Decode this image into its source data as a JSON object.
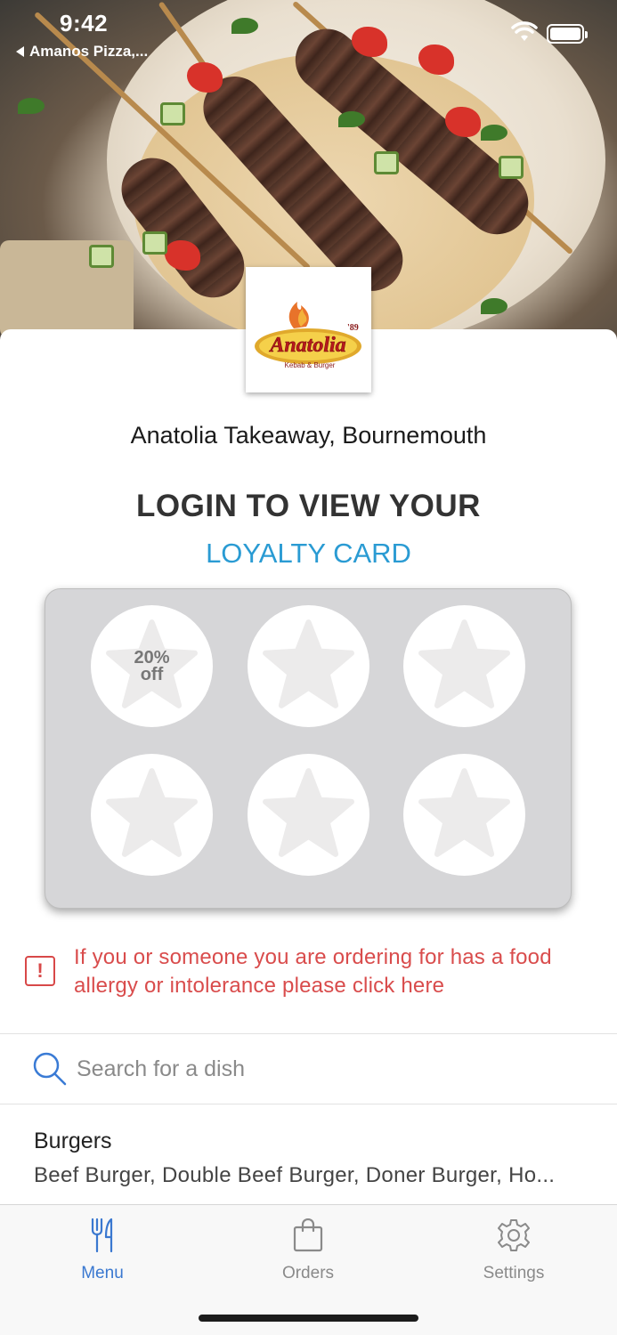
{
  "status_bar": {
    "time": "9:42",
    "back_app": "Amanos Pizza,..."
  },
  "restaurant": {
    "name": "Anatolia Takeaway, Bournemouth",
    "logo_text": "Anatolia",
    "logo_subtext": "Kebab & Burger",
    "logo_year": "'89"
  },
  "loyalty": {
    "heading": "LOGIN TO VIEW YOUR",
    "subheading": "LOYALTY CARD",
    "stamps": [
      {
        "label": "20%\noff"
      },
      {
        "label": ""
      },
      {
        "label": ""
      },
      {
        "label": ""
      },
      {
        "label": ""
      },
      {
        "label": ""
      }
    ],
    "stamp_label_line1": "20%",
    "stamp_label_line2": "off"
  },
  "allergy": {
    "text": "If you or someone you are ordering for has a food allergy or intolerance please click here",
    "color": "#d94c4c"
  },
  "search": {
    "placeholder": "Search for a dish"
  },
  "menu": {
    "categories": [
      {
        "title": "Burgers",
        "items": "Beef Burger, Double Beef Burger, Doner Burger, Ho..."
      }
    ]
  },
  "tabs": [
    {
      "label": "Menu",
      "icon": "fork-knife-icon",
      "active": true
    },
    {
      "label": "Orders",
      "icon": "shopping-bag-icon",
      "active": false
    },
    {
      "label": "Settings",
      "icon": "gear-icon",
      "active": false
    }
  ],
  "colors": {
    "accent": "#2a9bd3",
    "tab_active": "#3a78d0",
    "tab_inactive": "#8a8a8a",
    "card_bg": "#d6d6d8"
  }
}
